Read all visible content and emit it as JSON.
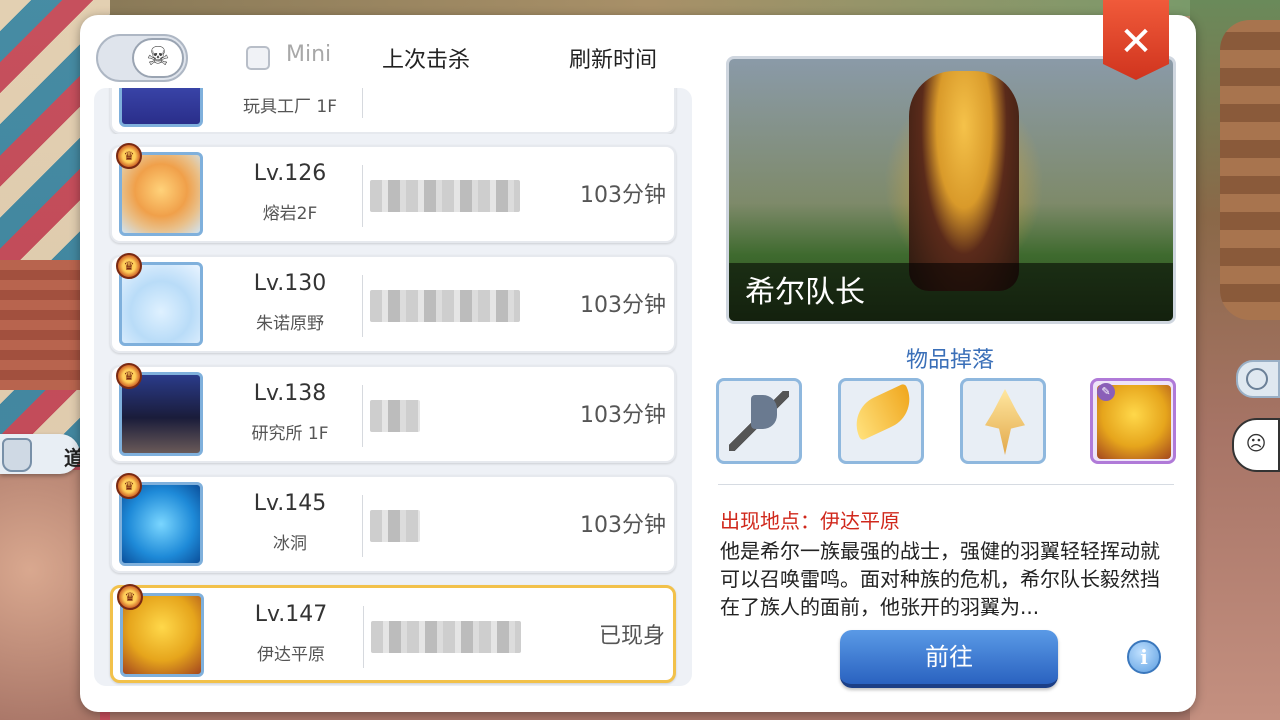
{
  "header": {
    "mini_label": "Mini",
    "col_last_kill": "上次击杀",
    "col_refresh": "刷新时间",
    "skull_glyph": "☠"
  },
  "partial_row": {
    "location": "玩具工厂 1F"
  },
  "rows": [
    {
      "level": "Lv.126",
      "location": "熔岩2F",
      "time": "103分钟",
      "portrait": "fire-demon"
    },
    {
      "level": "Lv.130",
      "location": "朱诺原野",
      "time": "103分钟",
      "portrait": "angel-poring"
    },
    {
      "level": "Lv.138",
      "location": "研究所 1F",
      "time": "103分钟",
      "portrait": "dark-swordsman"
    },
    {
      "level": "Lv.145",
      "location": "冰洞",
      "time": "103分钟",
      "portrait": "ice-golem"
    },
    {
      "level": "Lv.147",
      "location": "伊达平原",
      "time": "已现身",
      "portrait": "garuda-bird",
      "selected": true
    }
  ],
  "detail": {
    "monster_name": "希尔队长",
    "drops_title": "物品掉落",
    "drops": [
      "axe-icon",
      "feather-icon",
      "crystal-icon",
      "card-icon"
    ],
    "location_label": "出现地点：伊达平原",
    "description": "他是希尔一族最强的战士，强健的羽翼轻轻挥动就可以召唤雷鸣。面对种族的危机，希尔队长毅然挡在了族人的面前，他张开的羽翼为...",
    "go_label": "前往",
    "info_glyph": "i",
    "close_glyph": "✕"
  },
  "side": {
    "left_button_char": "道"
  },
  "colors": {
    "accent_blue": "#3a6fb8",
    "location_red": "#d0281c",
    "selected_border": "#f2c14a",
    "close_red": "#e04a2c"
  }
}
